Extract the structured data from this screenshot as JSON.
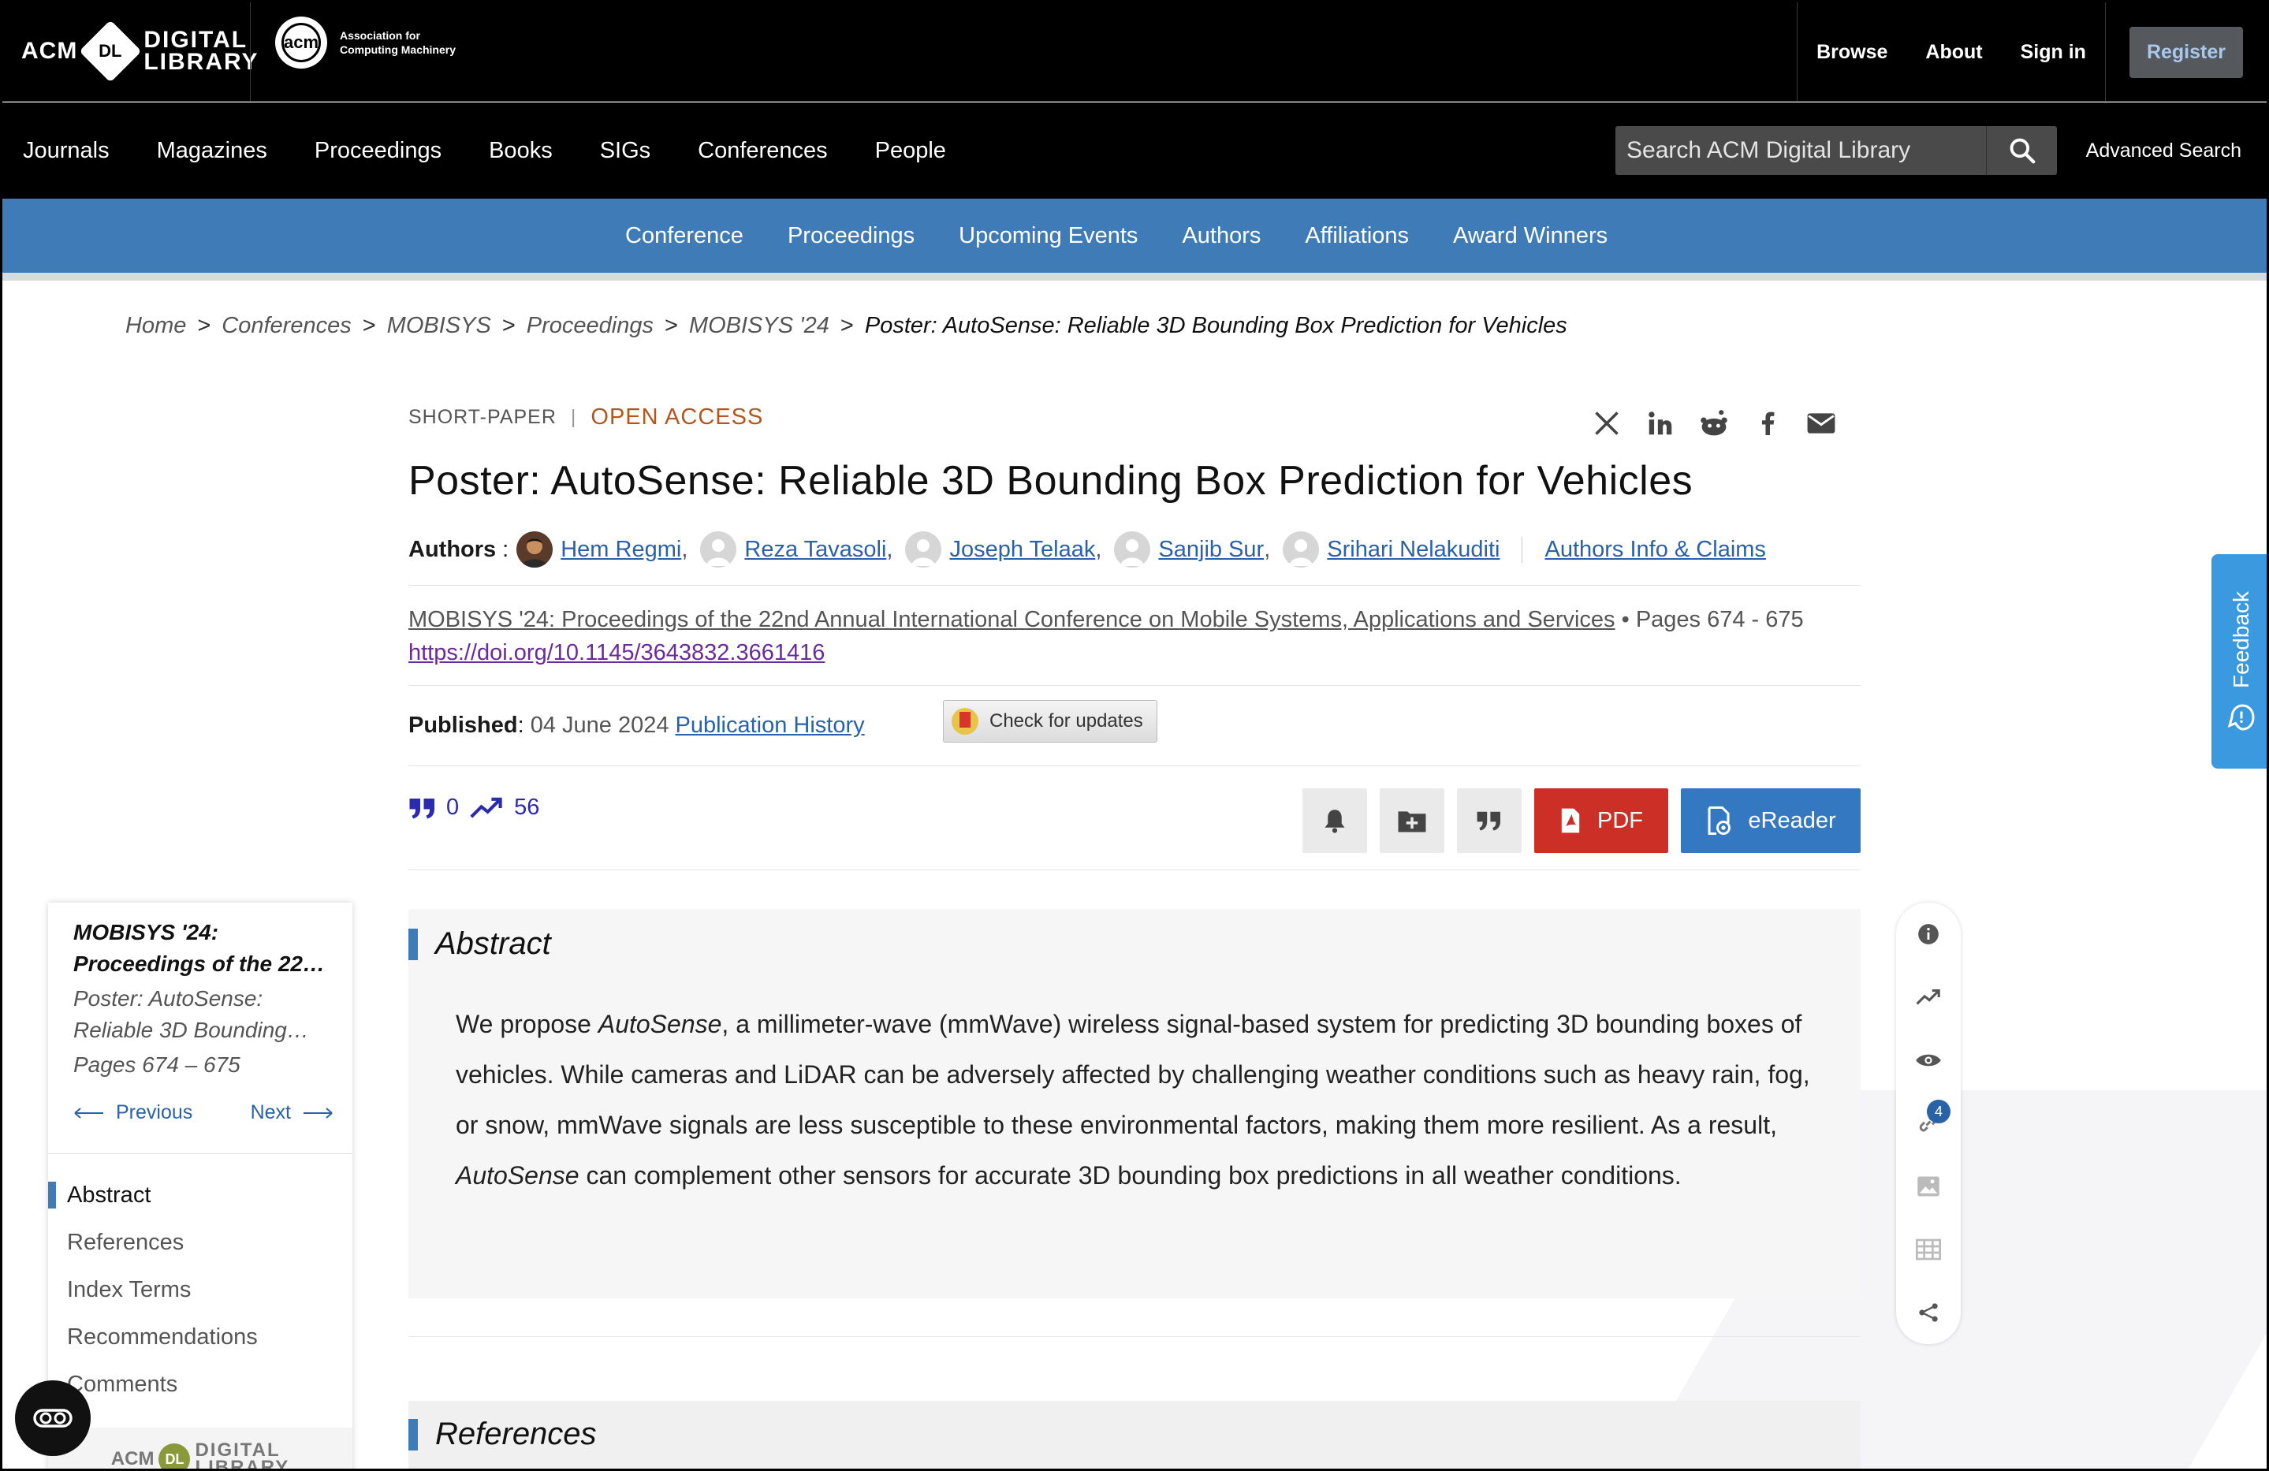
{
  "topbar": {
    "logo_acm": "ACM",
    "logo_dl": "DL",
    "logo_digital": "DIGITAL",
    "logo_library": "LIBRARY",
    "acm_badge": "acm",
    "acm_assoc_line1": "Association for",
    "acm_assoc_line2": "Computing Machinery",
    "browse": "Browse",
    "about": "About",
    "sign_in": "Sign in",
    "register": "Register"
  },
  "nav": {
    "items": [
      "Journals",
      "Magazines",
      "Proceedings",
      "Books",
      "SIGs",
      "Conferences",
      "People"
    ],
    "search_placeholder": "Search ACM Digital Library",
    "advanced_search": "Advanced Search"
  },
  "conf_nav": {
    "items": [
      "Conference",
      "Proceedings",
      "Upcoming Events",
      "Authors",
      "Affiliations",
      "Award Winners"
    ]
  },
  "breadcrumb": {
    "items": [
      "Home",
      "Conferences",
      "MOBISYS",
      "Proceedings",
      "MOBISYS '24"
    ],
    "current": "Poster: AutoSense: Reliable 3D Bounding Box Prediction for Vehicles",
    "separator": ">"
  },
  "article": {
    "type": "SHORT-PAPER",
    "type_sep": "|",
    "access": "OPEN ACCESS",
    "title": "Poster: AutoSense: Reliable 3D Bounding Box Prediction for Vehicles",
    "authors_label": "Authors",
    "authors": [
      "Hem Regmi",
      "Reza Tavasoli",
      "Joseph Telaak",
      "Sanjib Sur",
      "Srihari Nelakuditi"
    ],
    "authors_info": "Authors Info & Claims",
    "proceedings": "MOBISYS '24: Proceedings of the 22nd Annual International Conference on Mobile Systems, Applications and Services",
    "pages": "Pages 674 - 675",
    "bullet": "•",
    "doi": "https://doi.org/10.1145/3643832.3661416",
    "published_label": "Published",
    "published_date": "04 June 2024",
    "publication_history": "Publication History",
    "check_updates": "Check for updates",
    "citations": "0",
    "downloads": "56",
    "pdf": "PDF",
    "ereader": "eReader"
  },
  "abstract": {
    "heading": "Abstract",
    "text_1": "We propose ",
    "em_1": "AutoSense",
    "text_2": ", a millimeter-wave (mmWave) wireless signal-based system for predicting 3D bounding boxes of vehicles. While cameras and LiDAR can be adversely affected by challenging weather conditions such as heavy rain, fog, or snow, mmWave signals are less susceptible to these environmental factors, making them more resilient. As a result, ",
    "em_2": "AutoSense",
    "text_3": " can complement other sensors for accurate 3D bounding box predictions in all weather conditions."
  },
  "references": {
    "heading": "References"
  },
  "sidebar": {
    "proc_line1": "MOBISYS '24:",
    "proc_line2": "Proceedings of the 22n…",
    "paper_line1": "Poster: AutoSense:",
    "paper_line2": "Reliable 3D Bounding…",
    "pages": "Pages 674 – 675",
    "previous": "Previous",
    "next": "Next",
    "nav": [
      "Abstract",
      "References",
      "Index Terms",
      "Recommendations",
      "Comments"
    ],
    "footer_acm": "ACM",
    "footer_dl": "DL",
    "footer_digital": "DIGITAL",
    "footer_library": "LIBRARY"
  },
  "right_rail": {
    "links_count": "4"
  },
  "feedback": {
    "label": "Feedback"
  },
  "colors": {
    "brand_blue": "#3f7cb7",
    "pdf_red": "#cc2f25",
    "ereader_blue": "#3578c2",
    "open_access": "#b5561a"
  }
}
